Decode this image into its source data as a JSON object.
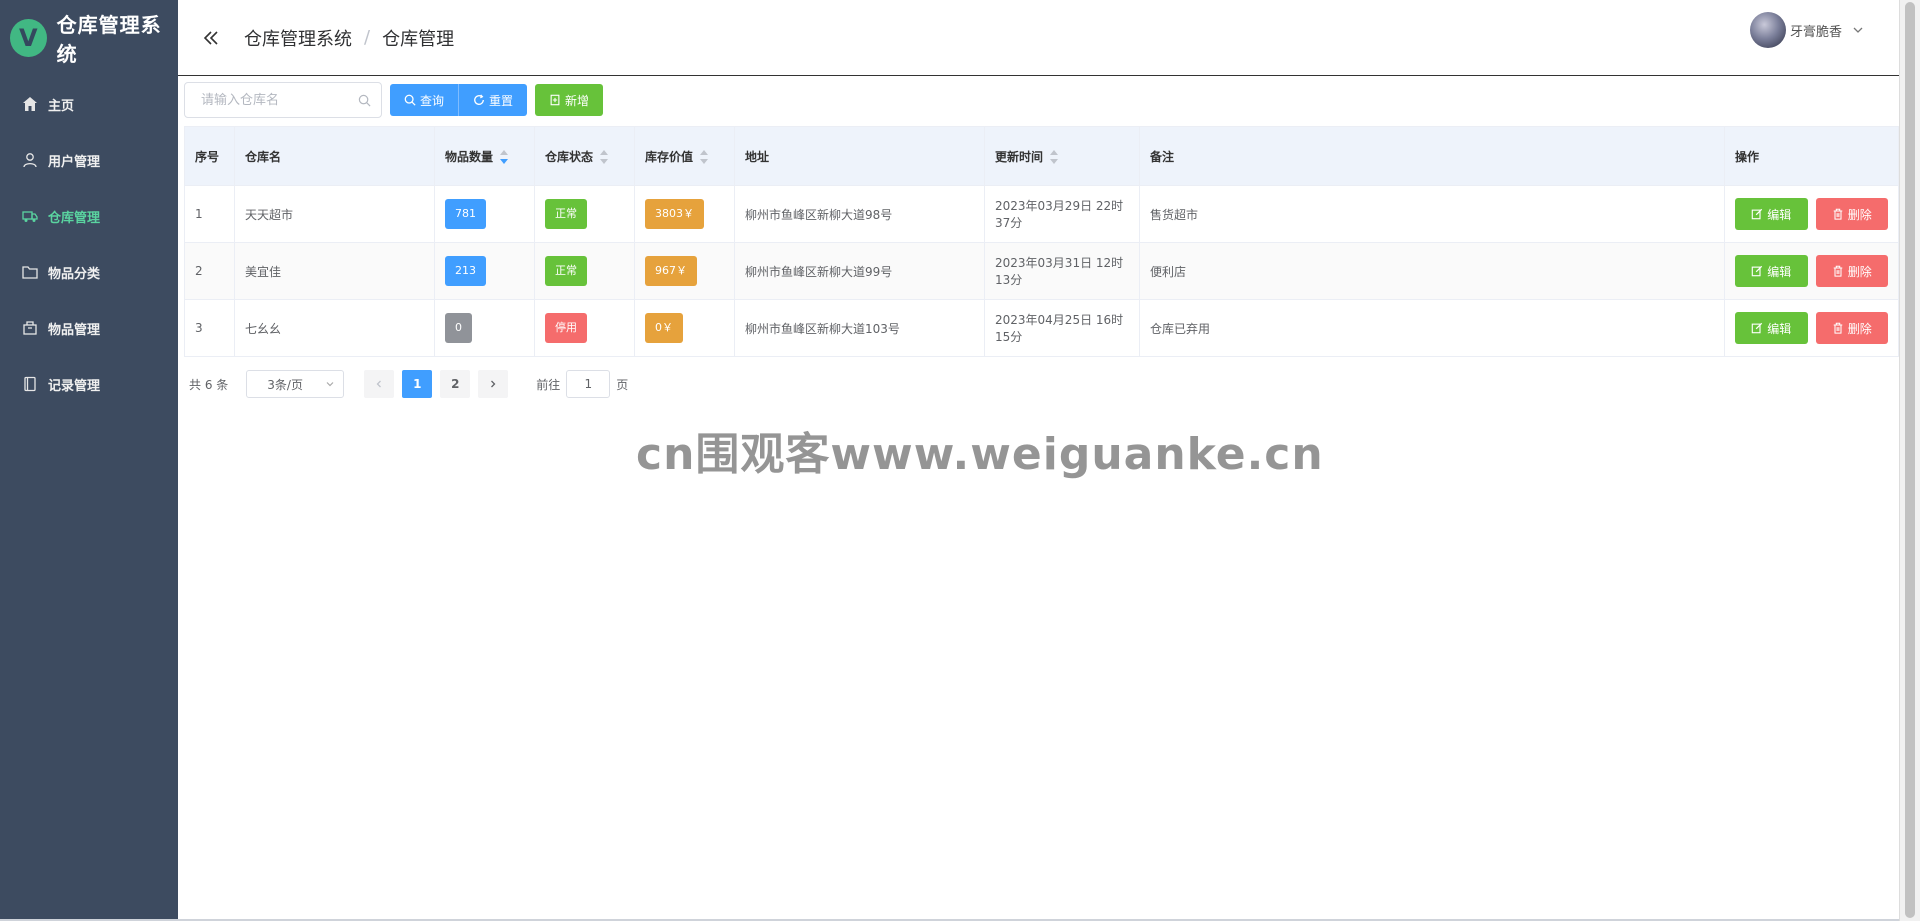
{
  "app": {
    "title": "仓库管理系统",
    "logo_letter": "V"
  },
  "sidebar": {
    "items": [
      {
        "label": "主页",
        "icon": "home-icon",
        "active": false
      },
      {
        "label": "用户管理",
        "icon": "user-icon",
        "active": false
      },
      {
        "label": "仓库管理",
        "icon": "truck-icon",
        "active": true
      },
      {
        "label": "物品分类",
        "icon": "folder-icon",
        "active": false
      },
      {
        "label": "物品管理",
        "icon": "box-icon",
        "active": false
      },
      {
        "label": "记录管理",
        "icon": "notebook-icon",
        "active": false
      }
    ]
  },
  "header": {
    "breadcrumb": [
      "仓库管理系统",
      "仓库管理"
    ],
    "separator": "/",
    "user_name": "牙膏脆香"
  },
  "toolbar": {
    "search_placeholder": "请输入仓库名",
    "query_label": "查询",
    "reset_label": "重置",
    "add_label": "新增"
  },
  "table": {
    "columns": [
      "序号",
      "仓库名",
      "物品数量",
      "仓库状态",
      "库存价值",
      "地址",
      "更新时间",
      "备注",
      "操作"
    ],
    "rows": [
      {
        "id": "1",
        "name": "天天超市",
        "count": "781",
        "status": "正常",
        "value": "3803￥",
        "address": "柳州市鱼峰区新柳大道98号",
        "time": "2023年03月29日 22时37分",
        "note": "售货超市"
      },
      {
        "id": "2",
        "name": "美宜佳",
        "count": "213",
        "status": "正常",
        "value": "967￥",
        "address": "柳州市鱼峰区新柳大道99号",
        "time": "2023年03月31日 12时13分",
        "note": "便利店"
      },
      {
        "id": "3",
        "name": "七幺幺",
        "count": "0",
        "status": "停用",
        "value": "0￥",
        "address": "柳州市鱼峰区新柳大道103号",
        "time": "2023年04月25日 16时15分",
        "note": "仓库已弃用"
      }
    ],
    "edit_label": "编辑",
    "delete_label": "删除"
  },
  "pagination": {
    "total_text": "共 6 条",
    "page_size": "3条/页",
    "pages": [
      "1",
      "2"
    ],
    "current": "1",
    "goto_label": "前往",
    "goto_value": "1",
    "page_suffix": "页"
  },
  "watermark": "cn围观客www.weiguanke.cn",
  "colors": {
    "sidebar_bg": "#3d4b60",
    "active_menu": "#5ad4a0",
    "primary": "#409eff",
    "success": "#67c23a",
    "danger": "#f56c6c",
    "warning": "#e6a23c",
    "info": "#909399"
  }
}
